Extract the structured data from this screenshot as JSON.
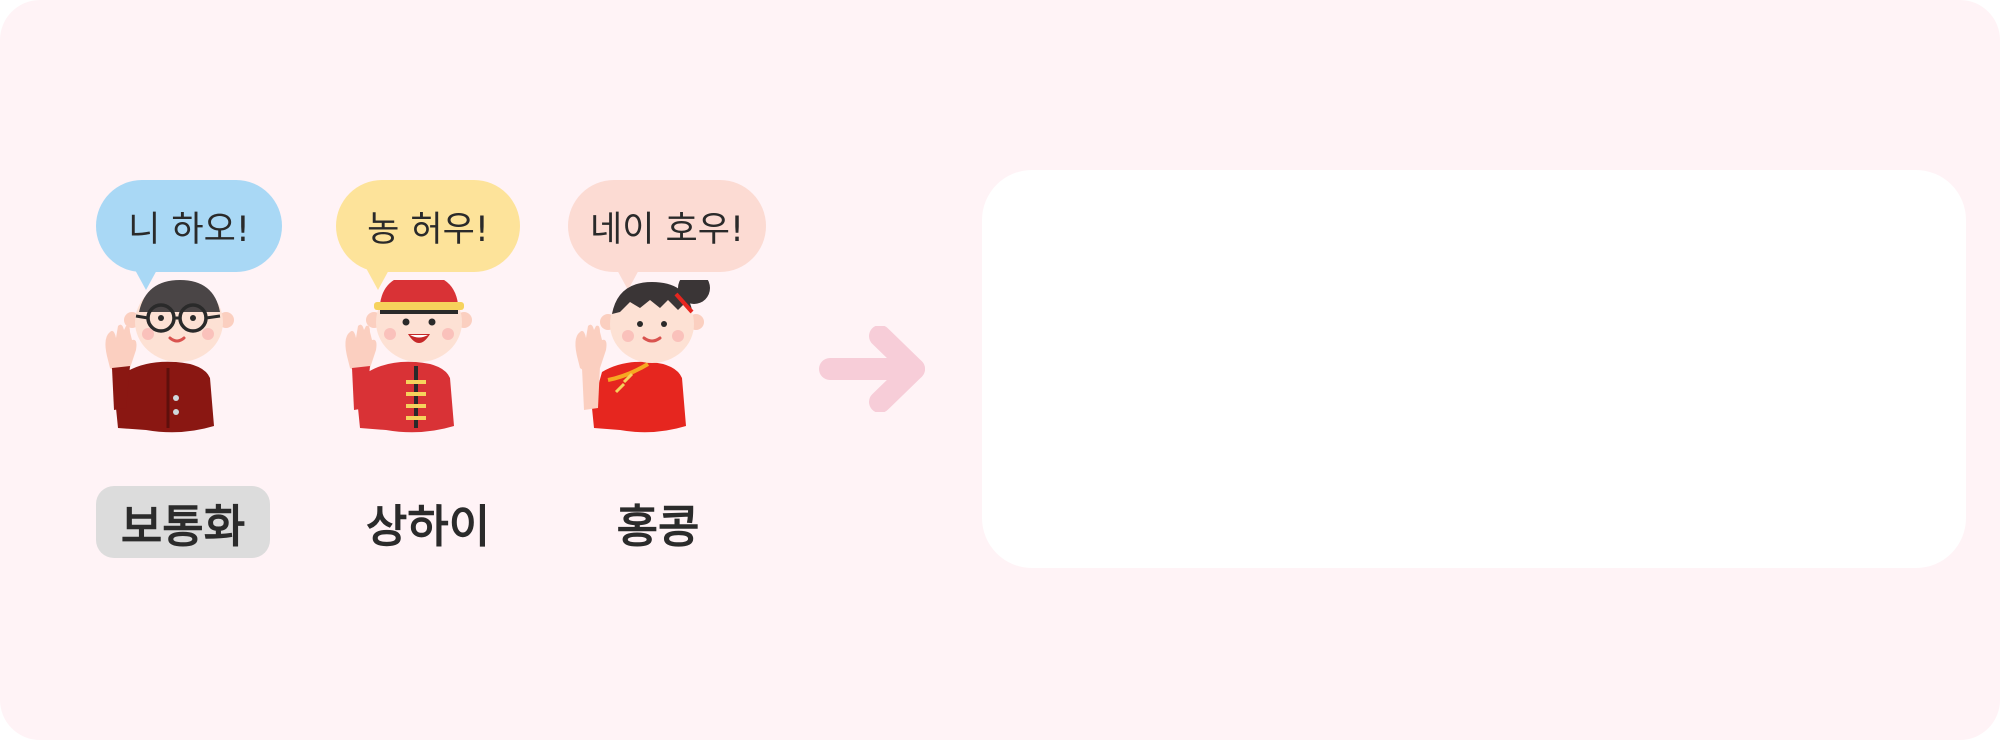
{
  "characters": [
    {
      "greeting": "니 하오!",
      "dialect": "보통화",
      "selected": true,
      "bubble_color": "#a9d8f5",
      "outfit_color": "#8a1712"
    },
    {
      "greeting": "농 허우!",
      "dialect": "상하이",
      "selected": false,
      "bubble_color": "#fde39a",
      "outfit_color": "#d93236"
    },
    {
      "greeting": "네이 호우!",
      "dialect": "홍콩",
      "selected": false,
      "bubble_color": "#fcdbd3",
      "outfit_color": "#e6261f"
    }
  ],
  "icons": {
    "arrow": "arrow-right-icon"
  },
  "colors": {
    "background": "#fff3f6",
    "result_box": "#ffffff",
    "arrow": "#f7cdd8",
    "selected_label_bg": "#dcdcdc"
  },
  "result": {
    "text": ""
  }
}
